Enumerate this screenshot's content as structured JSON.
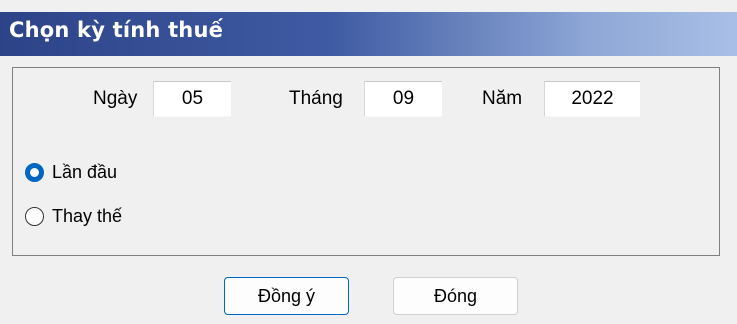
{
  "dialog": {
    "title": "Chọn kỳ tính thuế"
  },
  "date": {
    "day_label": "Ngày",
    "day_value": "05",
    "month_label": "Tháng",
    "month_value": "09",
    "year_label": "Năm",
    "year_value": "2022"
  },
  "options": [
    {
      "label": "Lần đầu",
      "checked": true
    },
    {
      "label": "Thay thế",
      "checked": false
    }
  ],
  "buttons": {
    "ok_label": "Đồng ý",
    "close_label": "Đóng"
  },
  "colors": {
    "title_gradient_start": "#2d4388",
    "title_gradient_end": "#a9bfe6",
    "accent": "#0067c0"
  }
}
